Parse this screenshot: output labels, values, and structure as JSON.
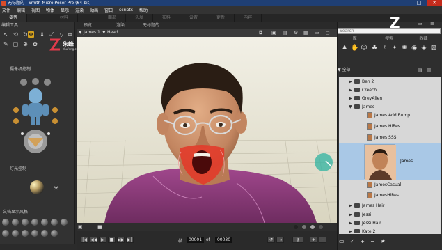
{
  "window": {
    "title": "无标题的 - Smith Micro Poser Pro (64-bit)",
    "minimize": "—",
    "maximize": "□",
    "close": "✕"
  },
  "menu": [
    "文件",
    "编辑",
    "视图",
    "物体",
    "显示",
    "渲染",
    "动画",
    "窗口",
    "scripts",
    "帮助"
  ],
  "room_tabs": [
    "姿势",
    "材料",
    "面部",
    "头发",
    "布料",
    "设置",
    "更新",
    "内容"
  ],
  "left_panel": {
    "editing_tools_header": "编辑工具",
    "camera_controls_header": "摄像机控制",
    "light_controls_header": "灯光控制",
    "display_style_header": "文档显示风格",
    "watermark": {
      "brand": "朱峰",
      "site": "zhufeng.com"
    }
  },
  "viewport": {
    "top_tabs": [
      "预览",
      "渲染"
    ],
    "document_title": "无标题的",
    "figure_selector": "James 1",
    "part_selector": "Head"
  },
  "timeline": {
    "frame_label": "帧",
    "current_frame": "00001",
    "separator": "of",
    "total_frames": "00030"
  },
  "library": {
    "search_placeholder": "Search",
    "tabs": [
      "库",
      "搜索",
      "收藏"
    ],
    "category_icons": [
      "figures-icon",
      "pose-icon",
      "expression-icon",
      "hair-icon",
      "hands-icon",
      "props-icon",
      "lights-icon",
      "cameras-icon",
      "materials-icon",
      "scenes-icon"
    ],
    "breadcrumb": "全部",
    "items": [
      {
        "label": "Ben 2",
        "kind": "folder",
        "selected": false
      },
      {
        "label": "Creech",
        "kind": "folder",
        "selected": false
      },
      {
        "label": "GreyAlien",
        "kind": "folder",
        "selected": false
      },
      {
        "label": "James",
        "kind": "folder-open",
        "selected": false
      },
      {
        "label": "James Add Bump",
        "kind": "figure",
        "selected": false
      },
      {
        "label": "James HiRes",
        "kind": "figure",
        "selected": false
      },
      {
        "label": "James SSS",
        "kind": "figure",
        "selected": false
      },
      {
        "label": "James",
        "kind": "figure-large",
        "selected": true
      },
      {
        "label": "JamesCasual",
        "kind": "figure",
        "selected": false
      },
      {
        "label": "JamesHiRes",
        "kind": "figure",
        "selected": false
      },
      {
        "label": "James Hair",
        "kind": "folder",
        "selected": false
      },
      {
        "label": "Jessi",
        "kind": "folder",
        "selected": false
      },
      {
        "label": "Jessi Hair",
        "kind": "folder",
        "selected": false
      },
      {
        "label": "Kate 2",
        "kind": "folder",
        "selected": false
      }
    ]
  },
  "colors": {
    "titlebar": "#1f3f74",
    "accent": "#d6a21e",
    "selected_row": "#a9c8e6",
    "shirt": "#8a3a78"
  }
}
